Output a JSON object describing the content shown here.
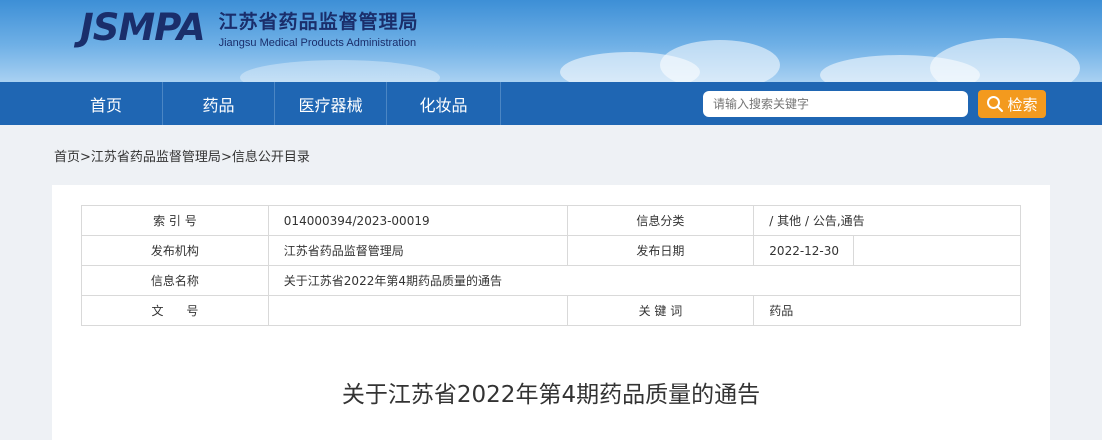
{
  "header": {
    "logo": "JSMPA",
    "org_name_cn": "江苏省药品监督管理局",
    "org_name_en": "Jiangsu Medical Products Administration"
  },
  "nav": {
    "items": [
      "首页",
      "药品",
      "医疗器械",
      "化妆品"
    ],
    "search_placeholder": "请输入搜索关键字",
    "search_button": "检索"
  },
  "breadcrumb": {
    "home": "首页",
    "sep": ">",
    "level1": "江苏省药品监督管理局",
    "level2": "信息公开目录"
  },
  "meta": {
    "index_label": "索 引 号",
    "index_value": "014000394/2023-00019",
    "category_label": "信息分类",
    "category_value": "/  其他  /  公告,通告",
    "publisher_label": "发布机构",
    "publisher_value": "江苏省药品监督管理局",
    "date_label": "发布日期",
    "date_value": "2022-12-30",
    "name_label": "信息名称",
    "name_value": "关于江苏省2022年第4期药品质量的通告",
    "docno_label": "文      号",
    "docno_value": "",
    "keywords_label": "关 键 词",
    "keywords_value": "药品"
  },
  "article": {
    "title": "关于江苏省2022年第4期药品质量的通告"
  }
}
